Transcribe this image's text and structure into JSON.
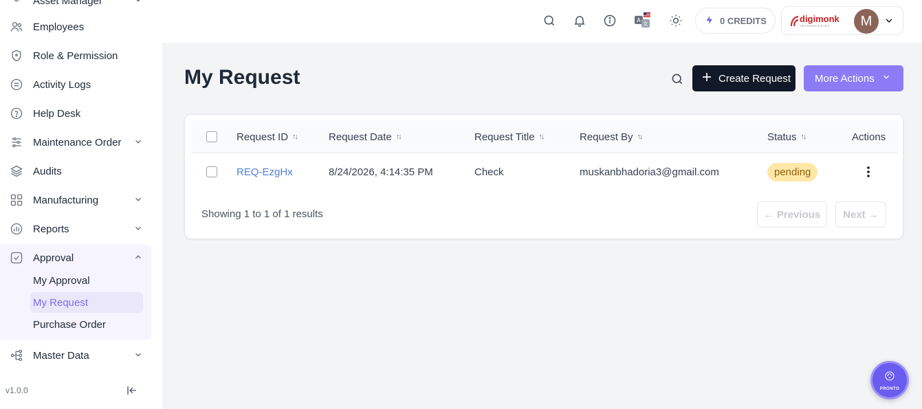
{
  "sidebar": {
    "items": [
      {
        "label": "Asset Manager",
        "icon": "asset-icon"
      },
      {
        "label": "Employees",
        "icon": "users-icon"
      },
      {
        "label": "Role & Permission",
        "icon": "shield-icon"
      },
      {
        "label": "Activity Logs",
        "icon": "list-icon"
      },
      {
        "label": "Help Desk",
        "icon": "help-icon"
      },
      {
        "label": "Maintenance Order",
        "icon": "sliders-icon"
      },
      {
        "label": "Audits",
        "icon": "layers-icon"
      },
      {
        "label": "Manufacturing",
        "icon": "grid-icon"
      },
      {
        "label": "Reports",
        "icon": "chart-icon"
      },
      {
        "label": "Approval",
        "icon": "check-square-icon"
      },
      {
        "label": "Master Data",
        "icon": "hierarchy-icon"
      }
    ],
    "approval_sub": [
      "My Approval",
      "My Request",
      "Purchase Order"
    ],
    "active_sub": "My Request",
    "version": "v1.0.0"
  },
  "topbar": {
    "credits": "0 CREDITS",
    "logo_text": "digimonk",
    "logo_sub": "TECHNOLOGIES",
    "avatar_initial": "M"
  },
  "page": {
    "title": "My Request",
    "create_label": "Create Request",
    "more_label": "More Actions"
  },
  "table": {
    "headers": [
      "Request ID",
      "Request Date",
      "Request Title",
      "Request By",
      "Status",
      "Actions"
    ],
    "rows": [
      {
        "id": "REQ-EzgHx",
        "date": "8/24/2026, 4:14:35 PM",
        "title": "Check",
        "by": "muskanbhadoria3@gmail.com",
        "status": "pending"
      }
    ],
    "summary": "Showing 1 to 1 of 1 results",
    "prev_label": "← Previous",
    "next_label": "Next →"
  },
  "fab": {
    "label": "PRONTO"
  },
  "colors": {
    "accent": "#8b7cf6",
    "primary_dark": "#111827",
    "link": "#4f7fd9",
    "pending_bg": "#fde8a8"
  }
}
